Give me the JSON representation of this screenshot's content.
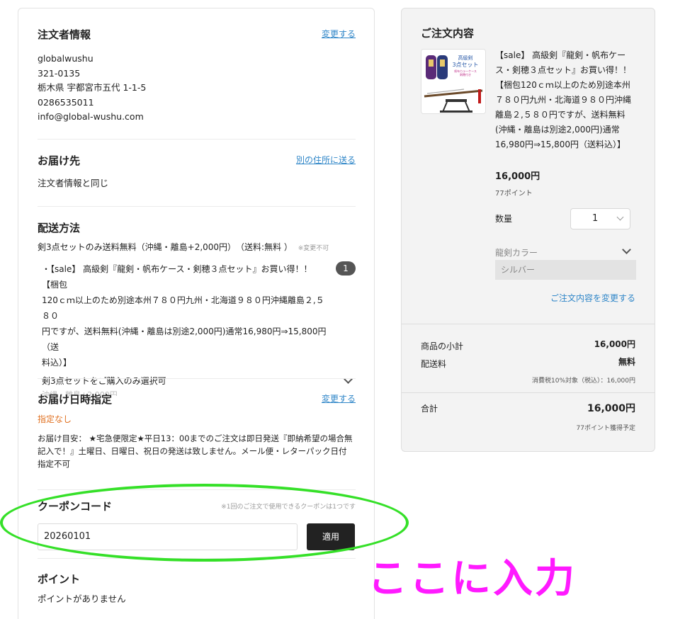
{
  "orderer": {
    "title": "注文者情報",
    "change_label": "変更する",
    "name": "globalwushu",
    "zip": "321-0135",
    "address": "栃木県 宇都宮市五代 1-1-5",
    "phone": "0286535011",
    "email": "info@global-wushu.com"
  },
  "delivery": {
    "title": "お届け先",
    "alt_link": "別の住所に送る",
    "value": "注文者情報と同じ"
  },
  "shipping": {
    "title": "配送方法",
    "method": "剣3点セットのみ送料無料（沖縄・離島+2,000円）　（送料:無料 ）",
    "note": "※変更不可",
    "item_line1": "・【sale】 高級剣『龍剣・帆布ケース・剣穂３点セット』お買い得！！【梱包",
    "item_line2": "120ｃｍ以上のため別途本州７８０円九州・北海道９８０円沖縄離島２,５８０",
    "item_line3": "円ですが、送料無料(沖縄・離島は別途2,000円)通常16,980円⇒15,800円（送",
    "item_line4": "料込）】",
    "qty": "1",
    "option": "剣3点セットをご購入のみ選択可",
    "option_sub": "沖縄・離島+2,000円"
  },
  "datetime": {
    "title": "お届け日時指定",
    "change_label": "変更する",
    "value": "指定なし",
    "note_line1": "お届け目安：  ★宅急便限定★平日13：00までのご注文は即日発送『即納希望の場合無",
    "note_line2": "記入で！』土曜日、日曜日、祝日の発送は致しません。メール便・レターパック日付",
    "note_line3": "指定不可"
  },
  "coupon": {
    "title": "クーポンコード",
    "note": "※1回のご注文で使用できるクーポンは1つです",
    "value": "20260101",
    "apply_label": "適用"
  },
  "points": {
    "title": "ポイント",
    "value": "ポイントがありません"
  },
  "summary": {
    "title": "ご注文内容",
    "product_title": "【sale】 高級剣『龍剣・帆布ケース・剣穂３点セット』お買い得！！【梱包120ｃｍ以上のため別途本州７８０円九州・北海道９８０円沖縄離島２,５８０円ですが、送料無料(沖縄・離島は別途2,000円)通常16,980円⇒15,800円（送料込）】",
    "price": "16,000円",
    "points": "77ポイント",
    "qty_label": "数量",
    "qty": "1",
    "color_label": "龍剣カラー",
    "color_value": "シルバー",
    "edit_link": "ご注文内容を変更する",
    "subtotal_label": "商品の小計",
    "subtotal": "16,000円",
    "shipping_label": "配送料",
    "shipping": "無料",
    "tax_note": "消費税10%対象（税込）：16,000円",
    "total_label": "合計",
    "total": "16,000円",
    "earn_points": "77ポイント獲得予定"
  },
  "thumbnail": {
    "caption_line1": "高級剣",
    "caption_line2": "3点セット",
    "caption_line3": "帆布カラーケース",
    "caption_line4": "剣穂付き"
  },
  "annotation": {
    "text": "ここに入力",
    "oval_color": "#35e028",
    "text_color": "#ff1aff"
  },
  "colors": {
    "link": "#2f86c8",
    "warning": "#e07020",
    "button": "#222222"
  }
}
